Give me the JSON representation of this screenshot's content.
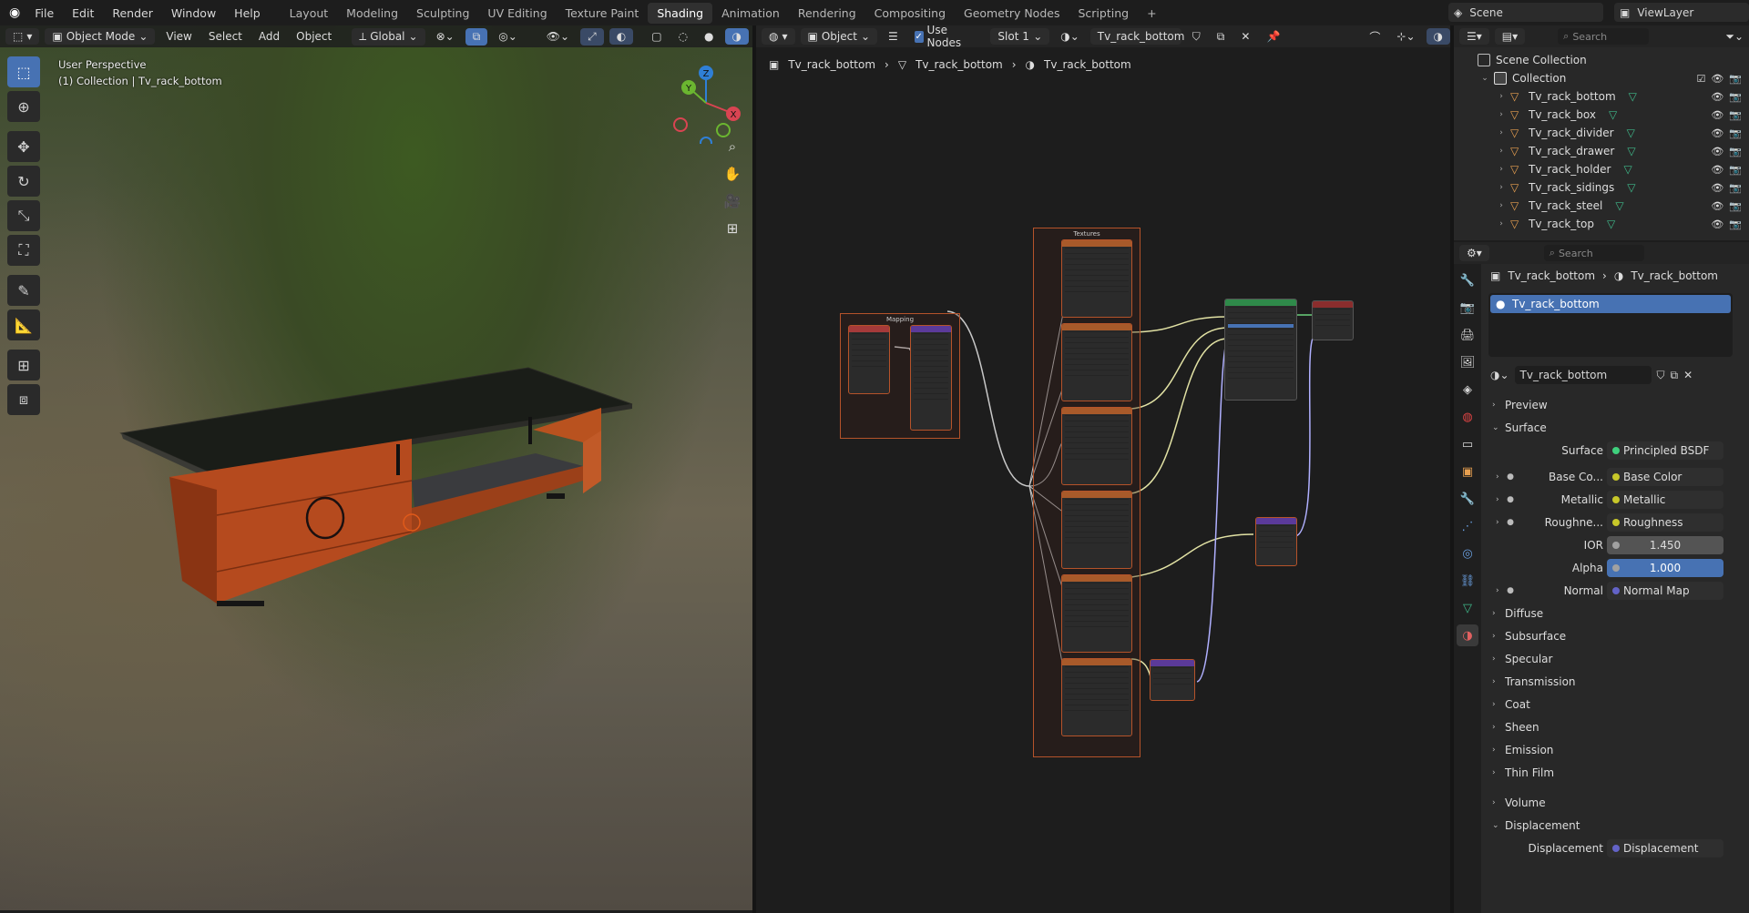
{
  "menubar": {
    "items": [
      "File",
      "Edit",
      "Render",
      "Window",
      "Help"
    ]
  },
  "workspaces": {
    "tabs": [
      "Layout",
      "Modeling",
      "Sculpting",
      "UV Editing",
      "Texture Paint",
      "Shading",
      "Animation",
      "Rendering",
      "Compositing",
      "Geometry Nodes",
      "Scripting"
    ],
    "active": "Shading"
  },
  "scene": {
    "name": "Scene",
    "view_layer": "ViewLayer"
  },
  "viewport": {
    "mode": "Object Mode",
    "menu": [
      "View",
      "Select",
      "Add",
      "Object"
    ],
    "transform": "Global",
    "overlay_line1": "User Perspective",
    "overlay_line2": "(1) Collection | Tv_rack_bottom",
    "gizmo_axes": [
      "X",
      "Y",
      "Z"
    ]
  },
  "node_editor": {
    "type": "Object",
    "use_nodes_label": "Use Nodes",
    "slot": "Slot 1",
    "material": "Tv_rack_bottom",
    "breadcrumb": [
      "Tv_rack_bottom",
      "Tv_rack_bottom",
      "Tv_rack_bottom"
    ],
    "frames": {
      "mapping": "Mapping",
      "textures": "Textures"
    }
  },
  "outliner": {
    "search_placeholder": "Search",
    "root": "Scene Collection",
    "collection": "Collection",
    "objects": [
      "Tv_rack_bottom",
      "Tv_rack_box",
      "Tv_rack_divider",
      "Tv_rack_drawer",
      "Tv_rack_holder",
      "Tv_rack_sidings",
      "Tv_rack_steel",
      "Tv_rack_top"
    ]
  },
  "properties": {
    "search_placeholder": "Search",
    "breadcrumb": [
      "Tv_rack_bottom",
      "Tv_rack_bottom"
    ],
    "slot_name": "Tv_rack_bottom",
    "material_name": "Tv_rack_bottom",
    "sections_top": [
      "Preview",
      "Surface"
    ],
    "surface": {
      "label": "Surface",
      "value": "Principled BSDF"
    },
    "inputs": [
      {
        "label": "Base Co...",
        "value": "Base Color",
        "color": "#c7c729"
      },
      {
        "label": "Metallic",
        "value": "Metallic",
        "color": "#a1a1a1"
      },
      {
        "label": "Roughne...",
        "value": "Roughness",
        "color": "#a1a1a1"
      }
    ],
    "ior": {
      "label": "IOR",
      "value": "1.450"
    },
    "alpha": {
      "label": "Alpha",
      "value": "1.000"
    },
    "normal": {
      "label": "Normal",
      "value": "Normal Map",
      "color": "#6363c7"
    },
    "subsections": [
      "Diffuse",
      "Subsurface",
      "Specular",
      "Transmission",
      "Coat",
      "Sheen",
      "Emission",
      "Thin Film"
    ],
    "volume": "Volume",
    "displacement_section": "Displacement",
    "displacement": {
      "label": "Displacement",
      "value": "Displacement",
      "color": "#6363c7"
    }
  },
  "colors": {
    "accent": "#4772b3",
    "frame": "#b5532a",
    "mesh": "#3fb98a"
  }
}
